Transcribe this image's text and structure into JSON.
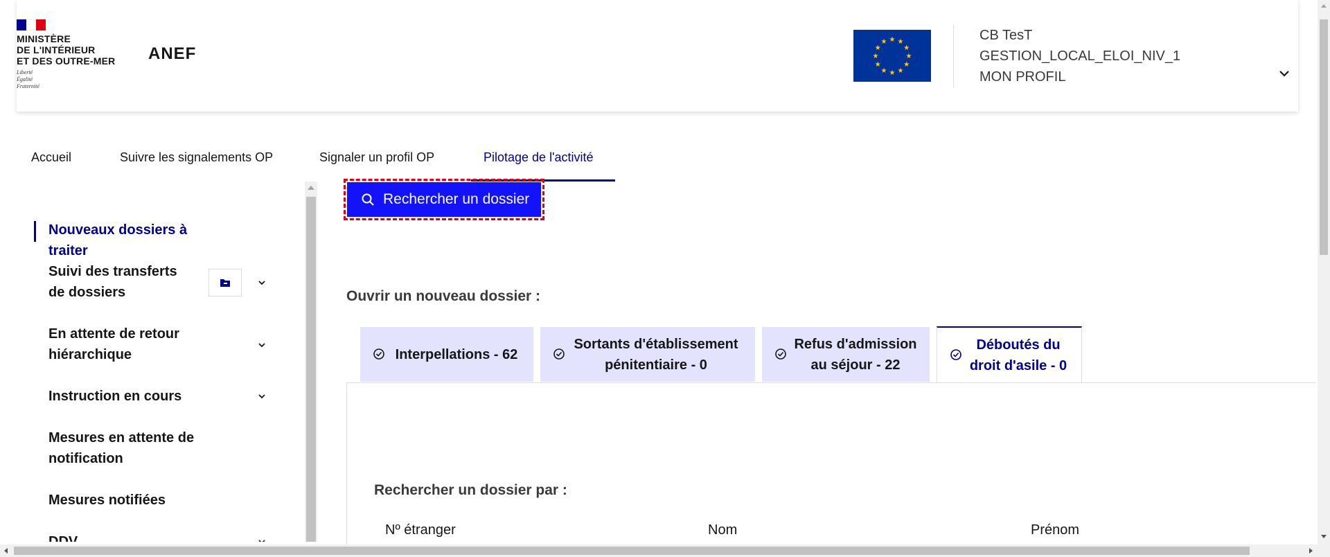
{
  "header": {
    "ministry_lines": [
      "MINISTÈRE",
      "DE L'INTÉRIEUR",
      "ET DES OUTRE-MER"
    ],
    "motto_lines": [
      "Liberté",
      "Égalité",
      "Fraternité"
    ],
    "service_name": "ANEF",
    "profile": {
      "user_name": "CB TesT",
      "role": "GESTION_LOCAL_ELOI_NIV_1",
      "profile_link": "MON PROFIL"
    }
  },
  "nav": {
    "items": [
      {
        "label": "Accueil"
      },
      {
        "label": "Suivre les signalements OP"
      },
      {
        "label": "Signaler un profil OP"
      },
      {
        "label": "Pilotage de l'activité",
        "active": true
      }
    ]
  },
  "sidebar": {
    "items": [
      {
        "label": "Nouveaux dossiers à traiter",
        "active": true
      },
      {
        "label": "Suivi des transferts de dossiers"
      },
      {
        "label": "En attente de retour hiérarchique"
      },
      {
        "label": "Instruction en cours"
      },
      {
        "label": "Mesures en attente de notification"
      },
      {
        "label": "Mesures notifiées"
      },
      {
        "label": "DDV"
      }
    ]
  },
  "main": {
    "search_button_label": "Rechercher un dossier",
    "open_title": "Ouvrir un nouveau dossier :",
    "tabs": [
      {
        "label": "Interpellations - 62"
      },
      {
        "label": "Sortants d'établissement pénitentiaire - 0"
      },
      {
        "label": "Refus d'admission au séjour - 22"
      },
      {
        "label": "Déboutés du droit d'asile - 0",
        "active": true
      }
    ],
    "search_by_title": "Rechercher un dossier par :",
    "columns": [
      "Nº étranger",
      "Nom",
      "Prénom"
    ]
  },
  "colors": {
    "primary": "#000091",
    "button_blue": "#1212ff",
    "tab_bg": "#e3e3fd",
    "focus_red": "#e1000f",
    "eu_blue": "#003399",
    "eu_gold": "#ffcc00"
  }
}
